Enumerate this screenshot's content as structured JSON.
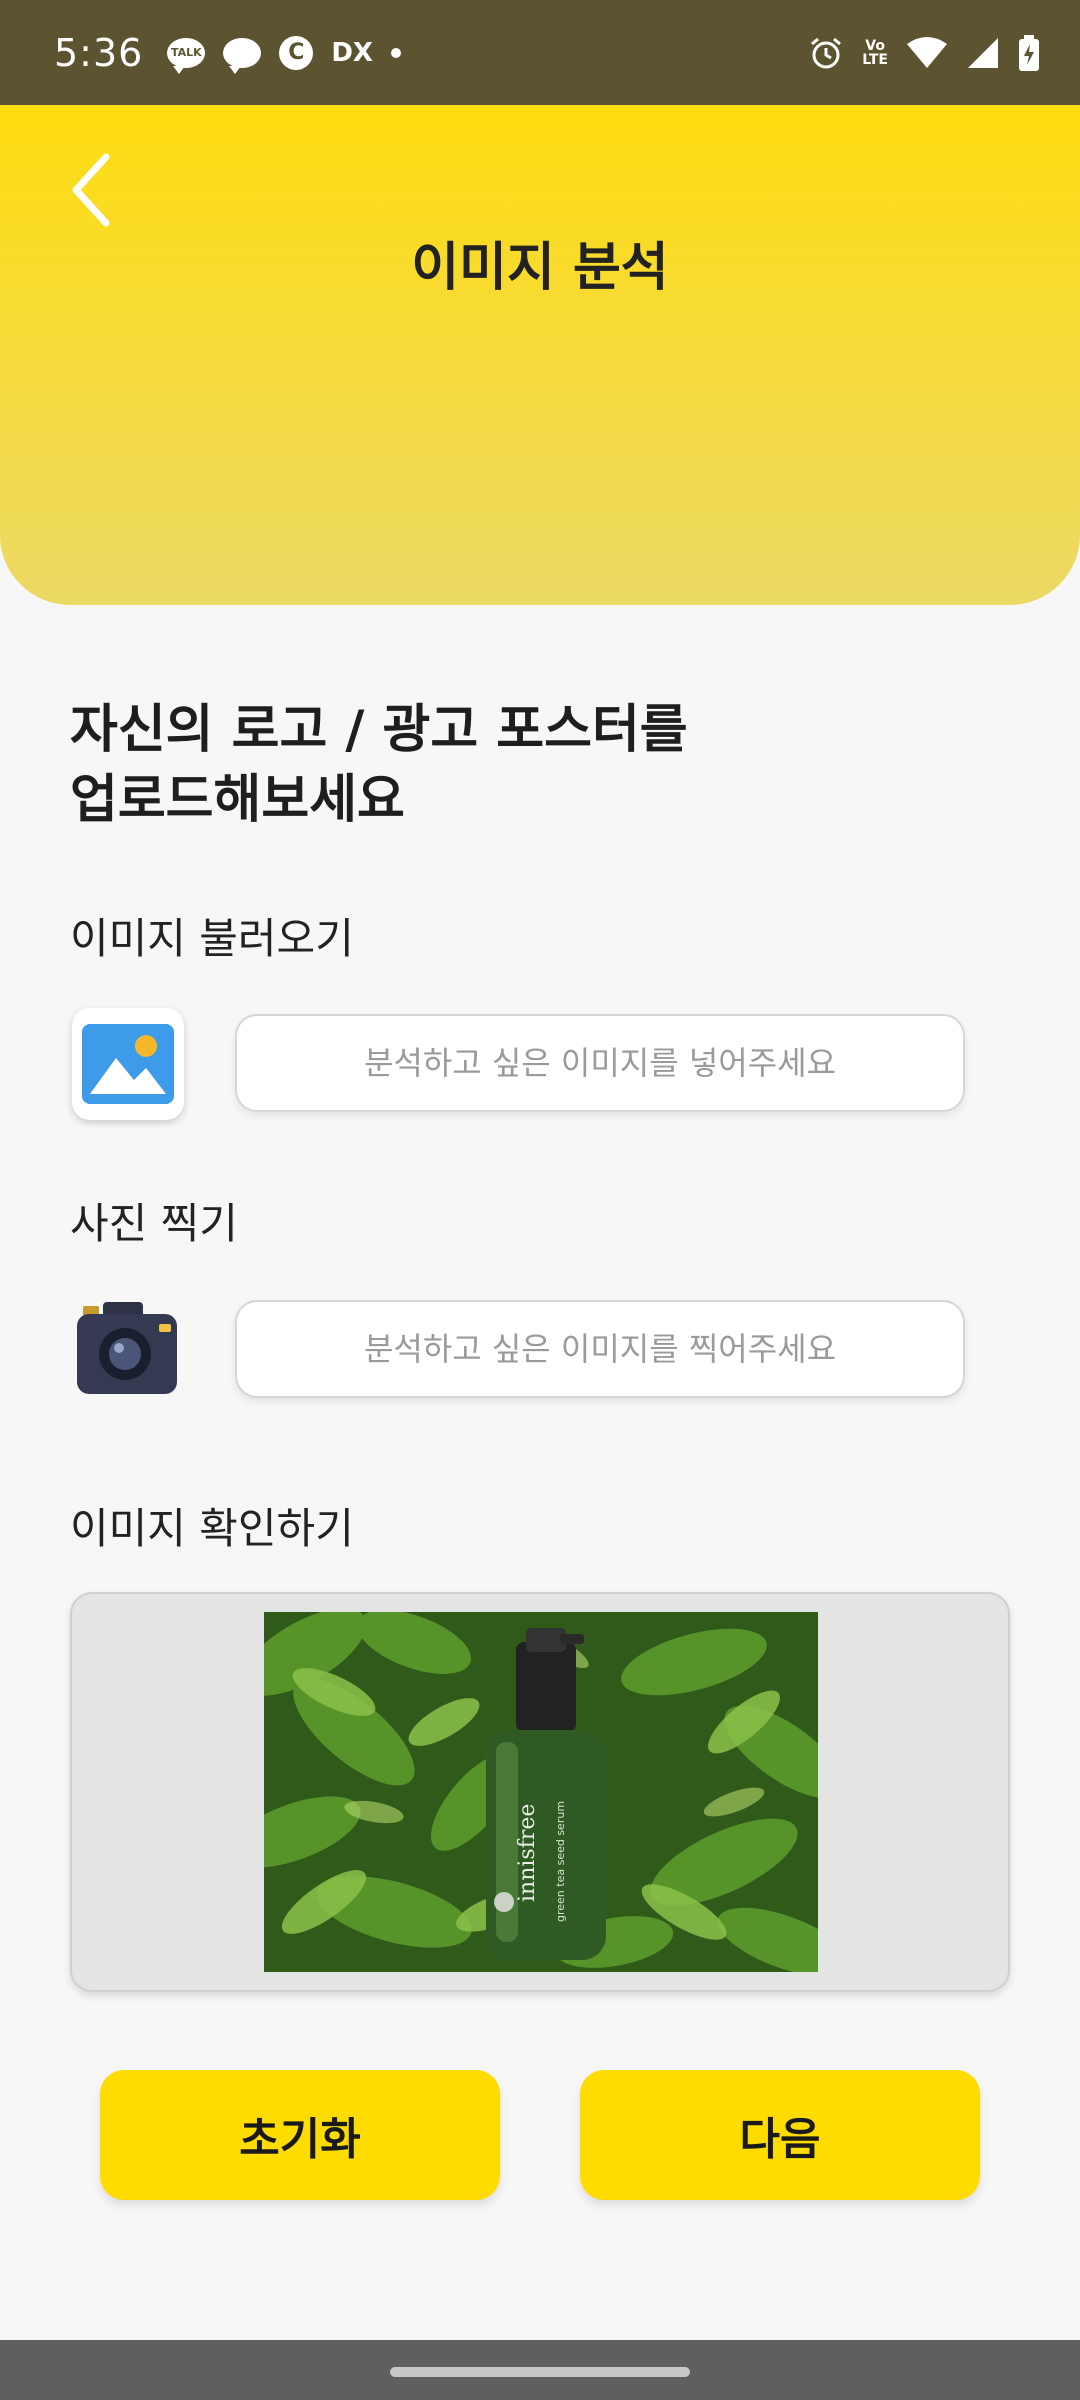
{
  "status_bar": {
    "time": "5:36",
    "talk_label": "TALK",
    "c_label": "C",
    "dx_label": "DX",
    "volte_top": "Vo",
    "volte_bottom": "LTE"
  },
  "header": {
    "title": "이미지 분석",
    "back_icon": "chevron-left-icon",
    "color_top": "#fedc0f",
    "color_bottom": "#ecd965"
  },
  "upload": {
    "heading_line1": "자신의 로고 / 광고 포스터를",
    "heading_line2": "업로드해보세요"
  },
  "load_image": {
    "label": "이미지 불러오기",
    "icon": "gallery-icon",
    "placeholder": "분석하고 싶은 이미지를 넣어주세요"
  },
  "take_photo": {
    "label": "사진 찍기",
    "icon": "camera-icon",
    "placeholder": "분석하고 싶은 이미지를 찍어주세요"
  },
  "preview": {
    "label": "이미지 확인하기",
    "image_brand": "innisfree",
    "image_product": "green tea seed serum"
  },
  "buttons": {
    "reset_label": "초기화",
    "next_label": "다음",
    "accent": "#fedc00"
  }
}
